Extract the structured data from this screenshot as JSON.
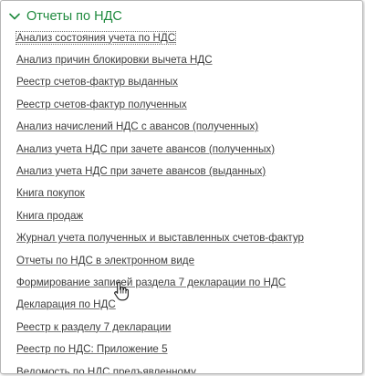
{
  "group": {
    "title": "Отчеты по НДС",
    "icon": "chevron-down-icon",
    "accent_color": "#1f8a3e"
  },
  "links": [
    {
      "label": "Анализ состояния учета по НДС",
      "focused": true
    },
    {
      "label": "Анализ причин блокировки вычета НДС"
    },
    {
      "label": "Реестр счетов-фактур выданных"
    },
    {
      "label": "Реестр счетов-фактур полученных"
    },
    {
      "label": "Анализ начислений НДС с авансов (полученных)"
    },
    {
      "label": "Анализ учета НДС при зачете авансов (полученных)"
    },
    {
      "label": "Анализ учета НДС при зачете авансов (выданных)"
    },
    {
      "label": "Книга покупок"
    },
    {
      "label": "Книга продаж"
    },
    {
      "label": "Журнал учета полученных и выставленных счетов-фактур"
    },
    {
      "label": "Отчеты по НДС в электронном виде"
    },
    {
      "label": "Формирование записей раздела 7 декларации по НДС"
    },
    {
      "label": "Декларация по НДС"
    },
    {
      "label": "Реестр к разделу 7 декларации"
    },
    {
      "label": "Реестр по НДС: Приложение 5"
    },
    {
      "label": "Ведомость по НДС предъявленному"
    }
  ],
  "pointer": {
    "icon": "hand-pointer-icon"
  }
}
